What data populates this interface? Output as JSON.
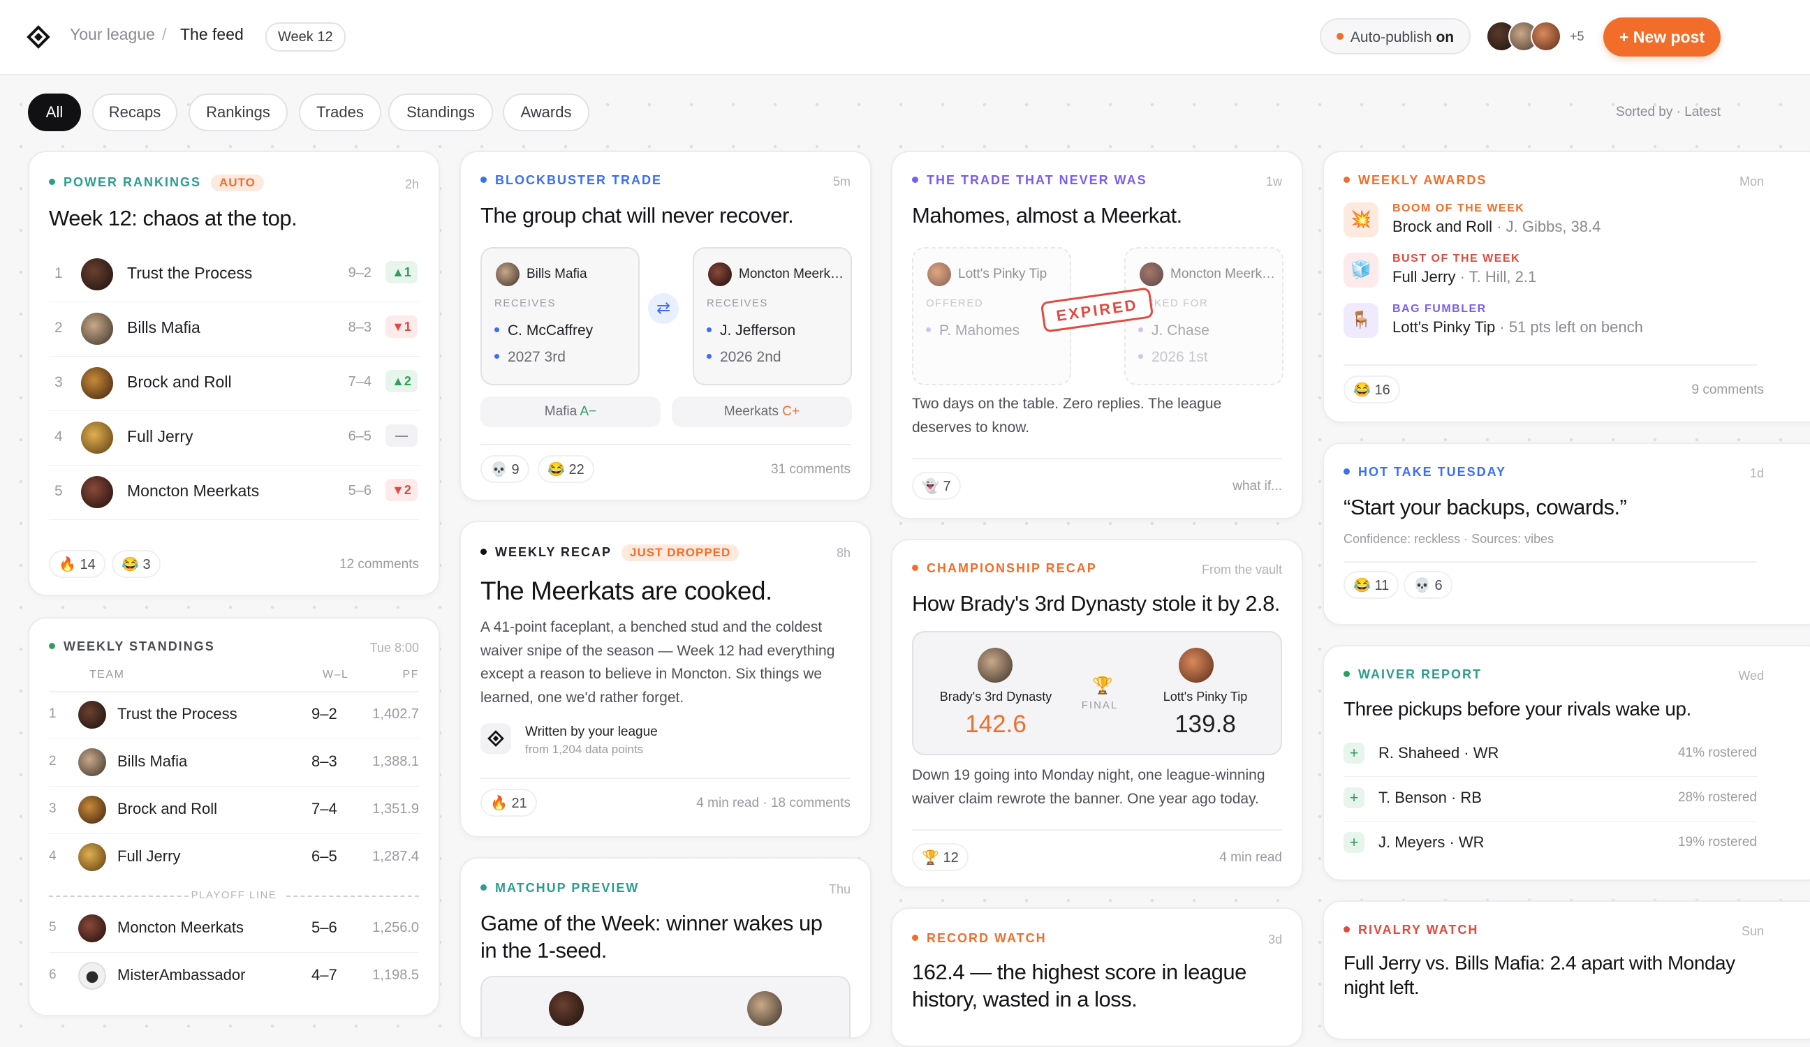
{
  "header": {
    "league": "Your league",
    "separator": "/",
    "page": "The feed",
    "week": "Week 12",
    "autopublish_label": "Auto-publish",
    "autopublish_state": "on",
    "members_more": "+5",
    "new_post": "+ New post"
  },
  "filters": [
    "All",
    "Recaps",
    "Rankings",
    "Trades",
    "Standings",
    "Awards"
  ],
  "sorted": "Sorted by · Latest",
  "power": {
    "kicker": "Power rankings",
    "badge": "AUTO",
    "time": "2h",
    "title": "Week 12: chaos at the top.",
    "rows": [
      {
        "rank": "1",
        "name": "Trust the Process",
        "record": "9–2",
        "move": "▲1",
        "dir": "up"
      },
      {
        "rank": "2",
        "name": "Bills Mafia",
        "record": "8–3",
        "move": "▼1",
        "dir": "down"
      },
      {
        "rank": "3",
        "name": "Brock and Roll",
        "record": "7–4",
        "move": "▲2",
        "dir": "up"
      },
      {
        "rank": "4",
        "name": "Full Jerry",
        "record": "6–5",
        "move": "—",
        "dir": "flat"
      },
      {
        "rank": "5",
        "name": "Moncton Meerkats",
        "record": "5–6",
        "move": "▼2",
        "dir": "down"
      }
    ],
    "reactions": [
      "🔥 14",
      "😂 3"
    ],
    "comments": "12 comments"
  },
  "standings": {
    "kicker": "Weekly standings",
    "time": "Tue 8:00",
    "col_team": "TEAM",
    "col_wl": "W–L",
    "col_pf": "PF",
    "playoff_line": "PLAYOFF LINE",
    "rows": [
      {
        "rank": "1",
        "name": "Trust the Process",
        "wl": "9–2",
        "pf": "1,402.7"
      },
      {
        "rank": "2",
        "name": "Bills Mafia",
        "wl": "8–3",
        "pf": "1,388.1"
      },
      {
        "rank": "3",
        "name": "Brock and Roll",
        "wl": "7–4",
        "pf": "1,351.9"
      },
      {
        "rank": "4",
        "name": "Full Jerry",
        "wl": "6–5",
        "pf": "1,287.4"
      },
      {
        "rank": "5",
        "name": "Moncton Meerkats",
        "wl": "5–6",
        "pf": "1,256.0"
      },
      {
        "rank": "6",
        "name": "MisterAmbassador",
        "wl": "4–7",
        "pf": "1,198.5"
      }
    ]
  },
  "trade": {
    "kicker": "Blockbuster trade",
    "time": "5m",
    "title": "The group chat will never recover.",
    "left": {
      "team": "Bills Mafia",
      "label": "RECEIVES",
      "items": [
        "C. McCaffrey",
        "2027 3rd"
      ]
    },
    "right": {
      "team": "Moncton Meerkats",
      "label": "RECEIVES",
      "items": [
        "J. Jefferson",
        "2026 2nd"
      ]
    },
    "grade_left_team": "Mafia",
    "grade_left": "A−",
    "grade_right_team": "Meerkats",
    "grade_right": "C+",
    "reactions": [
      "💀 9",
      "😂 22"
    ],
    "comments": "31 comments"
  },
  "recap": {
    "kicker": "Weekly recap",
    "badge": "JUST DROPPED",
    "time": "8h",
    "title": "The Meerkats are cooked.",
    "body": "A 41-point faceplant, a benched stud and the coldest waiver snipe of the season — Week 12 had everything except a reason to believe in Moncton. Six things we learned, one we'd rather forget.",
    "author": "Written by your league",
    "source": "from 1,204 data points",
    "reactions": [
      "🔥 21"
    ],
    "meta": "4 min read · 18 comments"
  },
  "matchup": {
    "kicker": "Matchup preview",
    "time": "Thu",
    "title": "Game of the Week: winner wakes up in the 1-seed."
  },
  "nevertrade": {
    "kicker": "The trade that never was",
    "time": "1w",
    "title": "Mahomes, almost a Meerkat.",
    "left": {
      "team": "Lott's Pinky Tip",
      "label": "OFFERED",
      "item": "P. Mahomes"
    },
    "right": {
      "team": "Moncton Meerkats",
      "label": "ASKED FOR",
      "items": [
        "J. Chase",
        "2026 1st"
      ]
    },
    "stamp": "EXPIRED",
    "body": "Two days on the table. Zero replies. The league deserves to know.",
    "reactions": [
      "👻 7"
    ],
    "foot": "what if..."
  },
  "champ": {
    "kicker": "Championship recap",
    "time": "From the vault",
    "title": "How Brady's 3rd Dynasty stole it by 2.8.",
    "left_team": "Brady's 3rd Dynasty",
    "left_score": "142.6",
    "right_team": "Lott's Pinky Tip",
    "right_score": "139.8",
    "final": "FINAL",
    "body": "Down 19 going into Monday night, one league-winning waiver claim rewrote the banner. One year ago today.",
    "reactions": [
      "🏆 12"
    ],
    "meta": "4 min read"
  },
  "record": {
    "kicker": "Record watch",
    "time": "3d",
    "title": "162.4 — the highest score in league history, wasted in a loss."
  },
  "awards": {
    "kicker": "Weekly awards",
    "time": "Mon",
    "items": [
      {
        "label": "BOOM OF THE WEEK",
        "team": "Brock and Roll",
        "detail": " · J. Gibbs, 38.4",
        "icon": "💥"
      },
      {
        "label": "BUST OF THE WEEK",
        "team": "Full Jerry",
        "detail": " · T. Hill, 2.1",
        "icon": "🧊"
      },
      {
        "label": "BAG FUMBLER",
        "team": "Lott's Pinky Tip",
        "detail": " · 51 pts left on bench",
        "icon": "🪑"
      }
    ],
    "reactions": [
      "😂 16"
    ],
    "comments": "9 comments"
  },
  "hottake": {
    "kicker": "Hot take tuesday",
    "time": "1d",
    "title": "“Start your backups, cowards.”",
    "meta": "Confidence: reckless · Sources: vibes",
    "reactions": [
      "😂 11",
      "💀 6"
    ]
  },
  "waiver": {
    "kicker": "Waiver report",
    "time": "Wed",
    "title": "Three pickups before your rivals wake up.",
    "rows": [
      {
        "name": "R. Shaheed · WR",
        "rostered": "41% rostered"
      },
      {
        "name": "T. Benson · RB",
        "rostered": "28% rostered"
      },
      {
        "name": "J. Meyers · WR",
        "rostered": "19% rostered"
      }
    ]
  },
  "rivalry": {
    "kicker": "Rivalry watch",
    "time": "Sun",
    "title": "Full Jerry vs. Bills Mafia: 2.4 apart with Monday night left."
  },
  "colors": {
    "accent": "#f26d2a",
    "green": "#2f9e5a",
    "blue": "#3b6ef5",
    "purple": "#7a5cf0",
    "red": "#e04a3f",
    "teal": "#2a9d8f"
  }
}
